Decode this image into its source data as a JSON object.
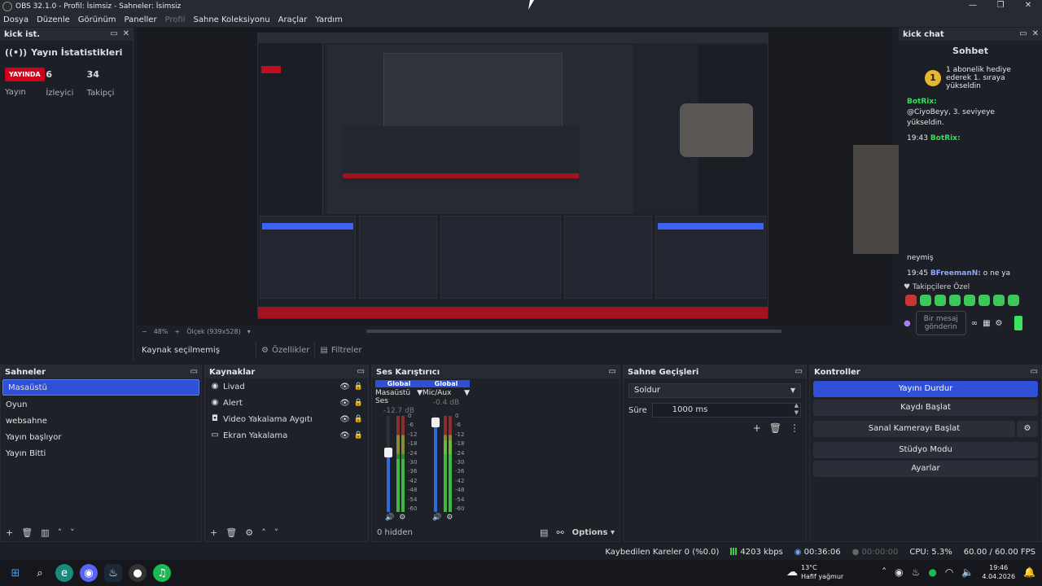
{
  "window": {
    "title": "OBS 32.1.0 - Profil: İsimsiz - Sahneler: İsimsiz",
    "controls": [
      "—",
      "❐",
      "✕"
    ]
  },
  "menu": [
    "Dosya",
    "Düzenle",
    "Görünüm",
    "Paneller",
    "Profil",
    "Sahne Koleksiyonu",
    "Araçlar",
    "Yardım"
  ],
  "stats_dock": {
    "header": "kick ist.",
    "title": "Yayın İstatistikleri",
    "live_badge": "YAYINDA",
    "live_label": "Yayın",
    "viewers": "6",
    "viewers_label": "İzleyici",
    "followers": "34",
    "followers_label": "Takipçi"
  },
  "preview": {
    "zoom": "48%",
    "canvas": "Ölçek (939x528)"
  },
  "source_toolbar": {
    "no_selection": "Kaynak seçilmemiş",
    "properties": "Özellikler",
    "filters": "Filtreler"
  },
  "chat_dock": {
    "header": "kick chat",
    "tab": "Sohbet",
    "gift_text": "1 abonelik hediye ederek 1. sıraya yükseldin",
    "gift_badge": "1",
    "msg1_prefix": "BotRix:",
    "msg1_text": "@CiyoBeyy, 3. seviyeye yükseldin.",
    "msg2_time": "19:43",
    "msg2_name": "BotRix:",
    "msg3_text": "neymiş",
    "msg4_time": "19:45",
    "msg4_name": "BFreemanN:",
    "msg4_text": "o ne ya",
    "subs_only": "Takipçilere Özel",
    "input_placeholder": "Bir mesaj gönderin"
  },
  "scenes": {
    "header": "Sahneler",
    "items": [
      "Masaüstü",
      "Oyun",
      "websahne",
      "Yayın başlıyor",
      "Yayın Bitti"
    ]
  },
  "sources": {
    "header": "Kaynaklar",
    "items": [
      "Livad",
      "Alert",
      "Video Yakalama Aygıtı",
      "Ekran Yakalama"
    ]
  },
  "mixer": {
    "header": "Ses Karıştırıcı",
    "global": "Global",
    "channels": [
      {
        "name": "Masaüstü Ses",
        "db": "-12.7 dB",
        "volume": 0.62,
        "level": 0.55
      },
      {
        "name": "Mic/Aux",
        "db": "-0.4 dB",
        "volume": 0.93,
        "level": 0.75
      }
    ],
    "scale": [
      "0",
      "-6",
      "-12",
      "-18",
      "-24",
      "-30",
      "-36",
      "-42",
      "-48",
      "-54",
      "-60"
    ],
    "hidden": "0 hidden",
    "options": "Options"
  },
  "transitions": {
    "header": "Sahne Geçişleri",
    "selected": "Soldur",
    "duration_label": "Süre",
    "duration": "1000 ms"
  },
  "controls": {
    "header": "Kontroller",
    "stop_stream": "Yayını Durdur",
    "start_record": "Kaydı Başlat",
    "virtual_cam": "Sanal Kamerayı Başlat",
    "studio_mode": "Stüdyo Modu",
    "settings": "Ayarlar"
  },
  "status": {
    "dropped": "Kaybedilen Kareler 0 (%0.0)",
    "bitrate": "4203 kbps",
    "stream_time": "00:36:06",
    "record_time": "00:00:00",
    "cpu": "CPU: 5.3%",
    "fps": "60.00 / 60.00 FPS"
  },
  "taskbar": {
    "temp": "13°C",
    "weather": "Hafif yağmur",
    "time": "19:46",
    "date": "4.04.2026"
  },
  "colors": {
    "accent": "#2f4fd6",
    "live": "#d0021b",
    "kick_green": "#53fc18"
  }
}
